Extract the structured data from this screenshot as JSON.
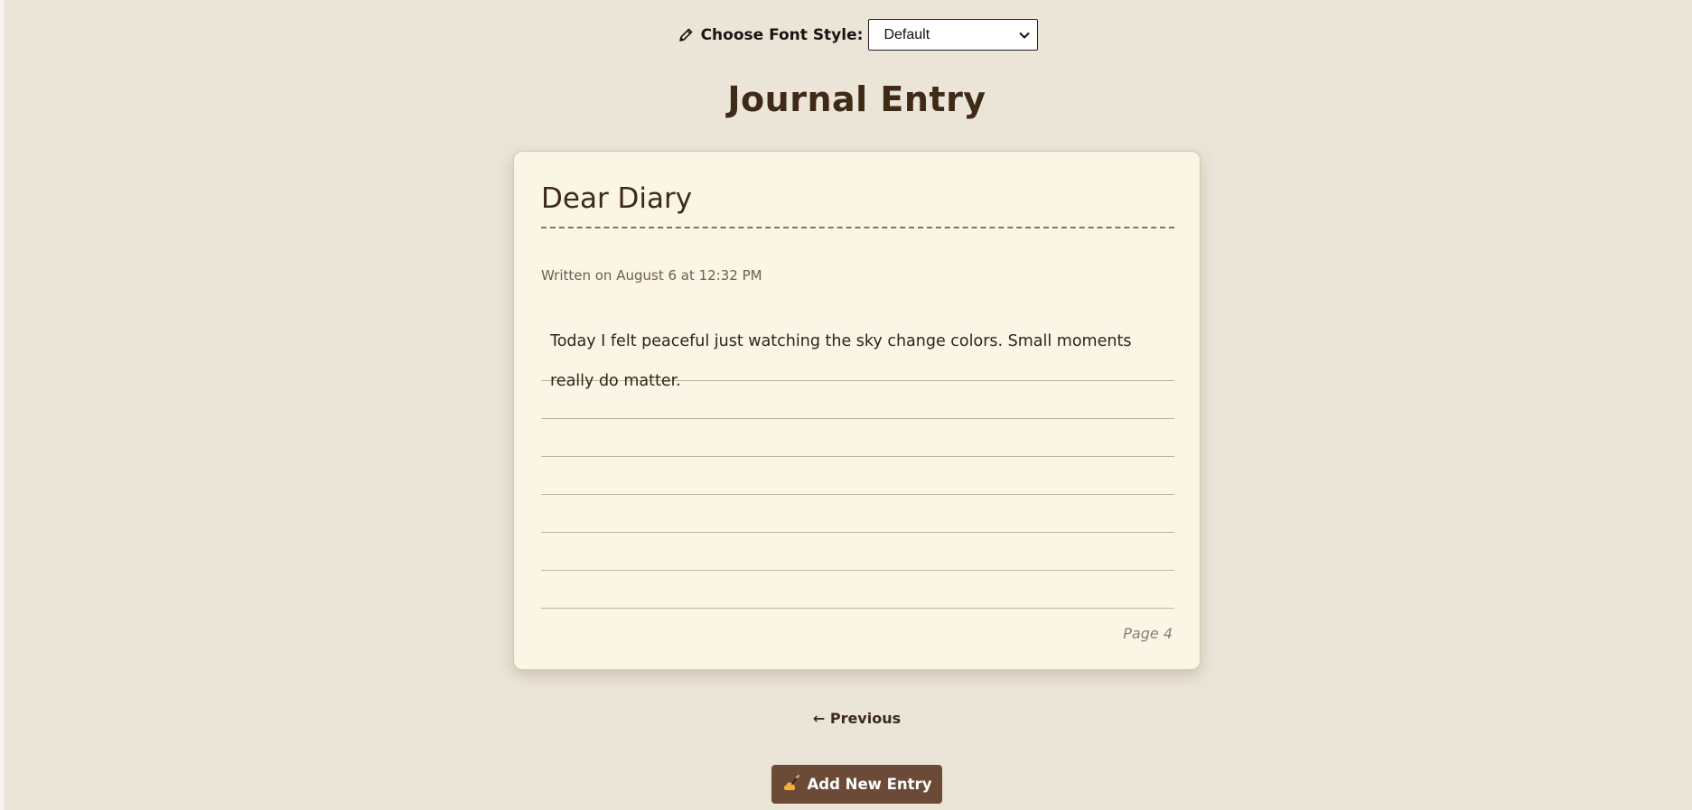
{
  "font_selector": {
    "label": "Choose Font Style:",
    "selected": "Default",
    "icon": "pencil-icon"
  },
  "page_title": "Journal Entry",
  "entry": {
    "title": "Dear Diary",
    "written_on": "Written on August 6 at 12:32 PM",
    "body": "Today I felt peaceful just watching the sky change colors. Small moments really do matter.",
    "page_label": "Page 4"
  },
  "nav": {
    "previous_label": "← Previous"
  },
  "actions": {
    "add_entry_label": "Add New Entry",
    "add_entry_icon": "writing-hand-icon"
  },
  "colors": {
    "background": "#ebe5d8",
    "card": "#fbf5e6",
    "accent_button": "#6b4a38",
    "title_text": "#3e2a17",
    "ruled_line": "#b7b79a"
  }
}
